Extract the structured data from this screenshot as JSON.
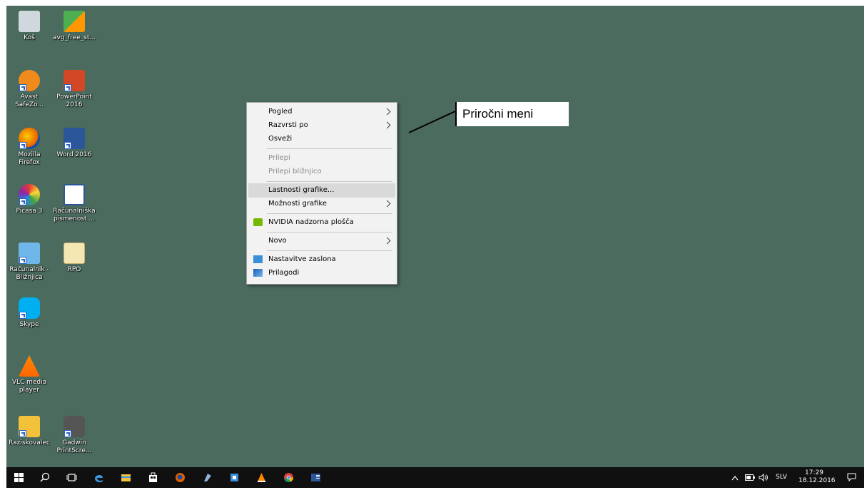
{
  "desktop": {
    "background_color": "#4a6b5e",
    "icons": [
      {
        "name": "recycle-bin-icon",
        "label": "Koš"
      },
      {
        "name": "avg-installer-icon",
        "label": "avg_free_st..."
      },
      {
        "name": "avast-safezone-icon",
        "label": "Avast SafeZo..."
      },
      {
        "name": "powerpoint-icon",
        "label": "PowerPoint 2016"
      },
      {
        "name": "firefox-icon",
        "label": "Mozilla Firefox"
      },
      {
        "name": "word-icon",
        "label": "Word 2016"
      },
      {
        "name": "picasa-icon",
        "label": "Picasa 3"
      },
      {
        "name": "word-document-icon",
        "label": "Računalniška pismenost ..."
      },
      {
        "name": "computer-icon",
        "label": "Računalnik - Bližnjica"
      },
      {
        "name": "folder-icon",
        "label": "RPO"
      },
      {
        "name": "skype-icon",
        "label": "Skype"
      },
      {
        "name": "vlc-icon",
        "label": "VLC media player"
      },
      {
        "name": "file-explorer-icon",
        "label": "Raziskovalec"
      },
      {
        "name": "gadwin-icon",
        "label": "Gadwin PrintScre..."
      }
    ]
  },
  "context_menu": {
    "items": [
      {
        "label": "Pogled",
        "submenu": true
      },
      {
        "label": "Razvrsti po",
        "submenu": true
      },
      {
        "label": "Osveži"
      },
      {
        "label": "Prilepi",
        "disabled": true
      },
      {
        "label": "Prilepi bližnjico",
        "disabled": true
      },
      {
        "label": "Lastnosti grafike..."
      },
      {
        "label": "Možnosti grafike",
        "submenu": true
      },
      {
        "label": "NVIDIA nadzorna plošča",
        "icon": "nvidia-icon"
      },
      {
        "label": "Novo",
        "submenu": true
      },
      {
        "label": "Nastavitve zaslona",
        "icon": "display-settings-icon"
      },
      {
        "label": "Prilagodi",
        "icon": "personalize-icon"
      }
    ]
  },
  "callout": {
    "text": "Priročni meni"
  },
  "taskbar": {
    "apps": [
      "start-icon",
      "search-icon",
      "task-view-icon",
      "edge-icon",
      "file-explorer-icon",
      "store-icon",
      "firefox-icon",
      "app-icon",
      "app2-icon",
      "vlc-icon",
      "chrome-icon",
      "word-icon"
    ],
    "tray": {
      "language": "SLV",
      "time": "17:29",
      "date": "18.12.2016"
    }
  }
}
